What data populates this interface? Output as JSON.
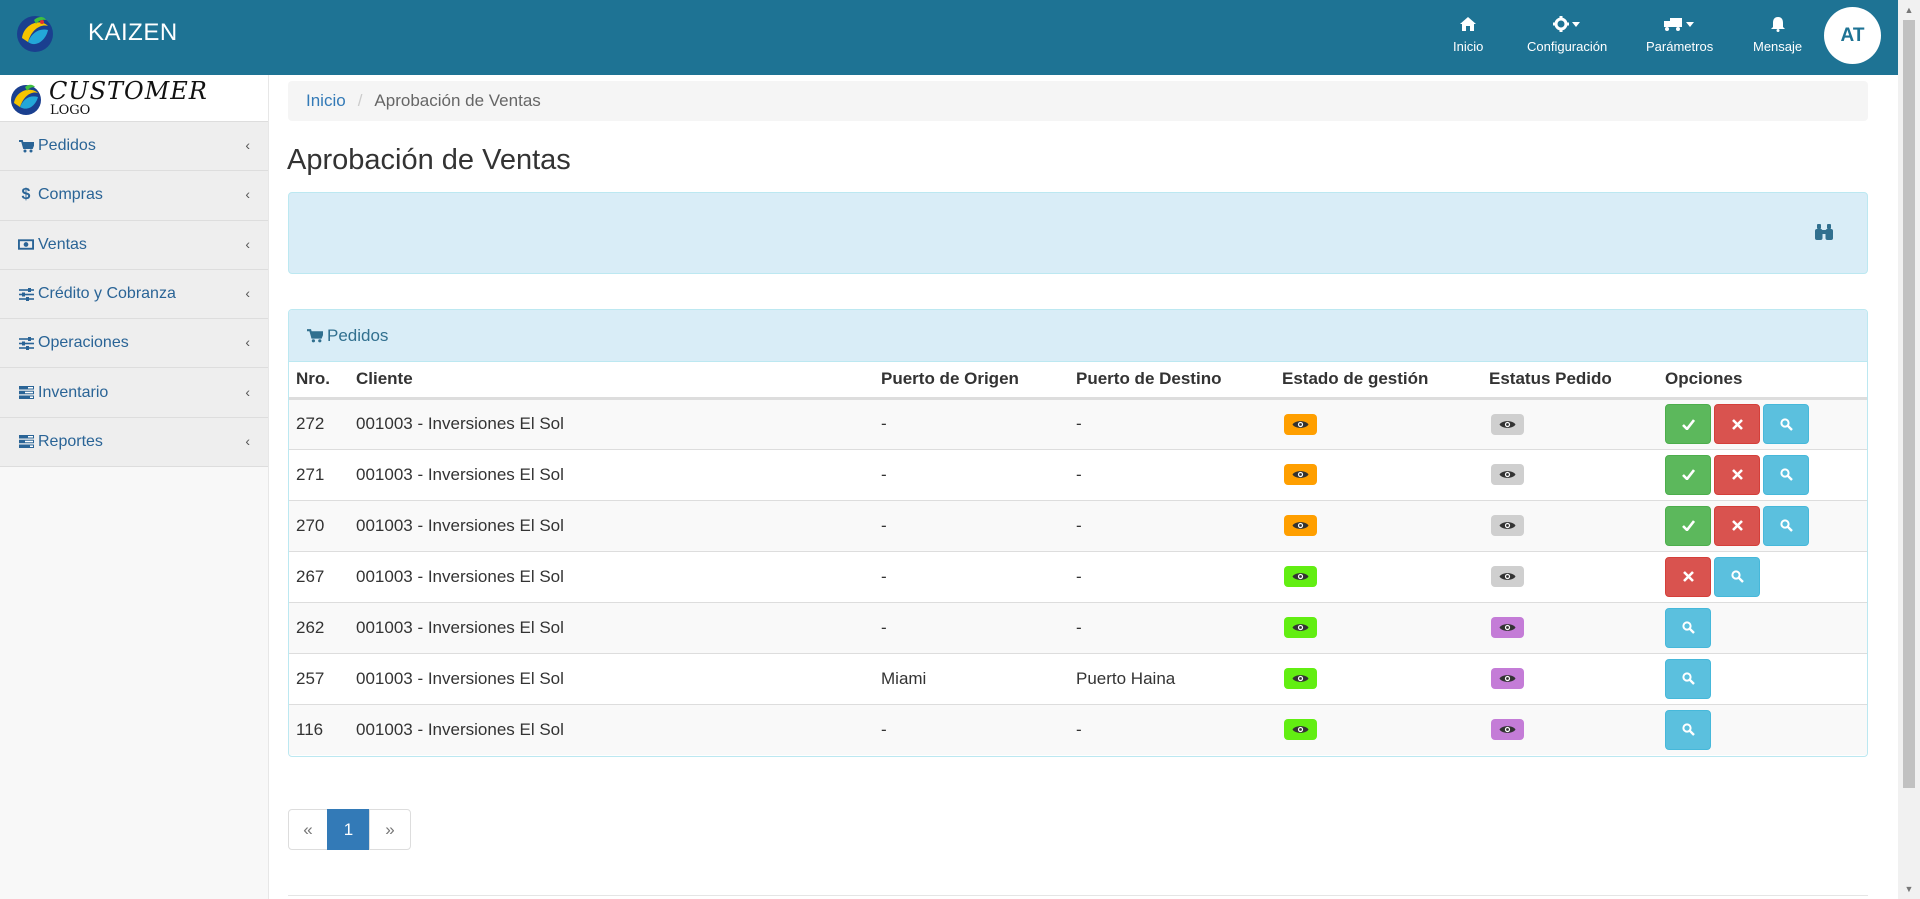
{
  "app": {
    "brand": "KAIZEN",
    "user_initials": "AT"
  },
  "topnav": [
    {
      "label": "Inicio",
      "icon": "home-icon"
    },
    {
      "label": "Configuración",
      "icon": "gear-icon"
    },
    {
      "label": "Parámetros",
      "icon": "truck-icon"
    },
    {
      "label": "Mensaje",
      "icon": "bell-icon"
    }
  ],
  "customer_logo": {
    "title": "CUSTOMER",
    "subtitle": "LOGO"
  },
  "sidebar": {
    "items": [
      {
        "label": "Pedidos",
        "icon": "cart-icon"
      },
      {
        "label": "Compras",
        "icon": "dollar-icon"
      },
      {
        "label": "Ventas",
        "icon": "money-icon"
      },
      {
        "label": "Crédito y Cobranza",
        "icon": "sliders-icon"
      },
      {
        "label": "Operaciones",
        "icon": "sliders-icon"
      },
      {
        "label": "Inventario",
        "icon": "tasks-icon"
      },
      {
        "label": "Reportes",
        "icon": "tasks-icon"
      }
    ]
  },
  "breadcrumb": {
    "home": "Inicio",
    "separator": "/",
    "current": "Aprobación de Ventas"
  },
  "page": {
    "title": "Aprobación de Ventas"
  },
  "orders": {
    "panel_title": "Pedidos",
    "columns": [
      "Nro.",
      "Cliente",
      "Puerto de Origen",
      "Puerto de Destino",
      "Estado de gestión",
      "Estatus Pedido",
      "Opciones"
    ],
    "rows": [
      {
        "nro": "272",
        "cliente": "001003 - Inversiones El Sol",
        "origen": "-",
        "destino": "-",
        "estado": "orange",
        "estatus": "grey",
        "actions": [
          "approve",
          "reject",
          "view"
        ]
      },
      {
        "nro": "271",
        "cliente": "001003 - Inversiones El Sol",
        "origen": "-",
        "destino": "-",
        "estado": "orange",
        "estatus": "grey",
        "actions": [
          "approve",
          "reject",
          "view"
        ]
      },
      {
        "nro": "270",
        "cliente": "001003 - Inversiones El Sol",
        "origen": "-",
        "destino": "-",
        "estado": "orange",
        "estatus": "grey",
        "actions": [
          "approve",
          "reject",
          "view"
        ]
      },
      {
        "nro": "267",
        "cliente": "001003 - Inversiones El Sol",
        "origen": "-",
        "destino": "-",
        "estado": "green",
        "estatus": "grey",
        "actions": [
          "reject",
          "view"
        ]
      },
      {
        "nro": "262",
        "cliente": "001003 - Inversiones El Sol",
        "origen": "-",
        "destino": "-",
        "estado": "green",
        "estatus": "purple",
        "actions": [
          "view"
        ]
      },
      {
        "nro": "257",
        "cliente": "001003 - Inversiones El Sol",
        "origen": "Miami",
        "destino": "Puerto Haina",
        "estado": "green",
        "estatus": "purple",
        "actions": [
          "view"
        ]
      },
      {
        "nro": "116",
        "cliente": "001003 - Inversiones El Sol",
        "origen": "-",
        "destino": "-",
        "estado": "green",
        "estatus": "purple",
        "actions": [
          "view"
        ]
      }
    ]
  },
  "pagination": {
    "prev": "«",
    "current": "1",
    "next": "»"
  },
  "colors": {
    "navbar": "#1e7394",
    "badge_orange": "#ff9f00",
    "badge_green": "#62ee12",
    "badge_grey": "#cfcfcf",
    "badge_purple": "#c47cd7",
    "btn_success": "#5cb85c",
    "btn_danger": "#d9534f",
    "btn_info": "#5bc0de"
  }
}
